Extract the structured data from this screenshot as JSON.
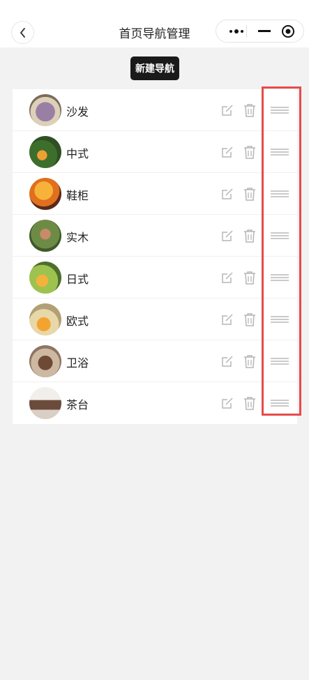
{
  "nav": {
    "title": "首页导航管理",
    "back_icon": "chevron-left-icon",
    "more_icon": "more-dots-icon",
    "minimize_icon": "minimize-icon",
    "close_icon": "target-circle-icon"
  },
  "toolbar": {
    "new_label": "新建导航"
  },
  "list": {
    "items": [
      {
        "label": "沙发",
        "avatar_color": "#8a6b8f"
      },
      {
        "label": "中式",
        "avatar_color": "#4f7f3a"
      },
      {
        "label": "鞋柜",
        "avatar_color": "#e0892b"
      },
      {
        "label": "实木",
        "avatar_color": "#6f8a4a"
      },
      {
        "label": "日式",
        "avatar_color": "#8fb24b"
      },
      {
        "label": "欧式",
        "avatar_color": "#d5b06a"
      },
      {
        "label": "卫浴",
        "avatar_color": "#7b6253"
      },
      {
        "label": "茶台",
        "avatar_color": "#b9a596"
      }
    ],
    "edit_icon": "edit-icon",
    "delete_icon": "trash-icon",
    "drag_icon": "drag-handle-icon"
  },
  "colors": {
    "accent_dark": "#1a1a1a",
    "highlight": "#e84a4a",
    "page_bg": "#f2f2f2"
  }
}
